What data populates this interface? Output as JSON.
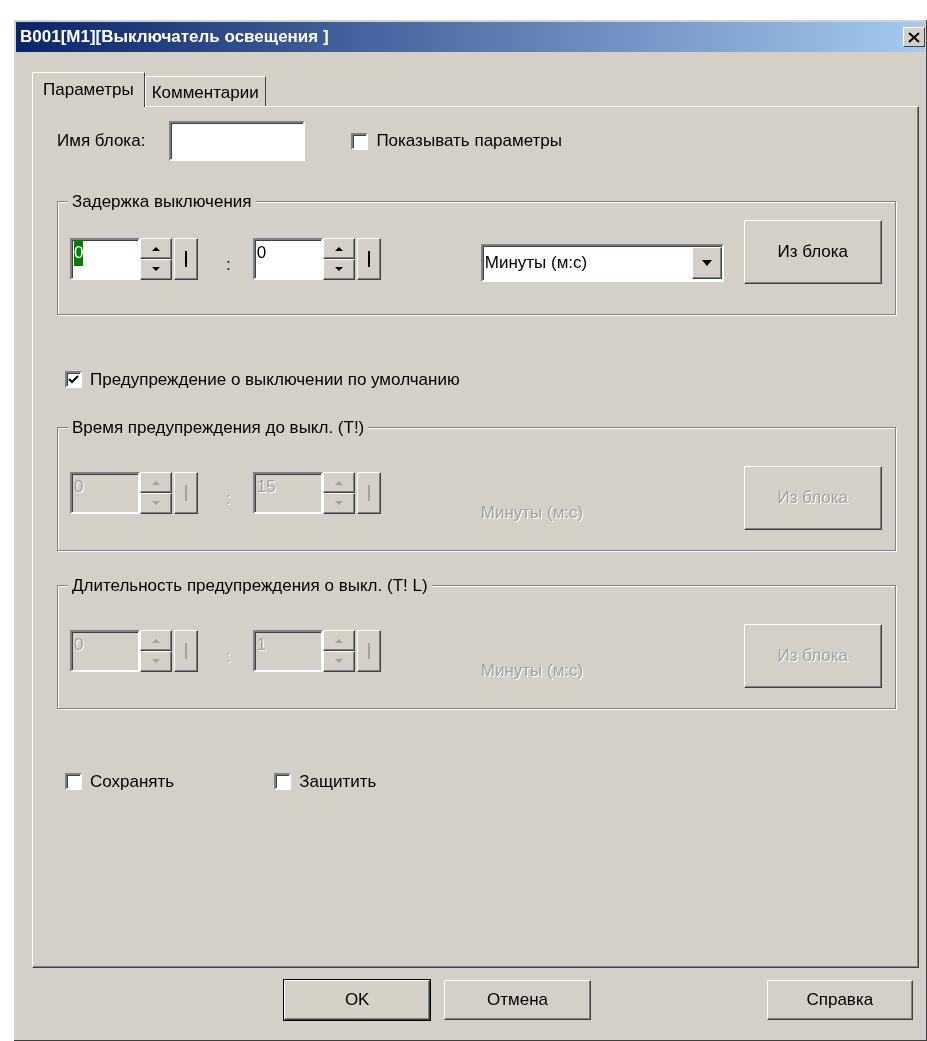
{
  "window": {
    "title": "B001[M1][Выключатель освещения ]"
  },
  "tabs": [
    {
      "label": "Параметры",
      "selected": true
    },
    {
      "label": "Комментарии",
      "selected": false
    }
  ],
  "block_name": {
    "label": "Имя блока:"
  },
  "show_params": {
    "label": "Показывать параметры",
    "checked": false
  },
  "groups": [
    {
      "title": "Задержка выключения",
      "disabled": false,
      "fields": [
        {
          "value": "0",
          "focused": true
        },
        {
          "value": "0",
          "focused": false
        }
      ],
      "separator": ":",
      "unit": {
        "kind": "select",
        "text": "Минуты (м:с)"
      },
      "button": "Из блока"
    },
    {
      "kind": "check",
      "label": "Предупреждение о выключении по умолчанию",
      "checked": true
    },
    {
      "title": "Время предупреждения до выкл. (T!)",
      "disabled": true,
      "fields": [
        {
          "value": "0",
          "focused": false
        },
        {
          "value": "15",
          "focused": false
        }
      ],
      "separator": ":",
      "unit": {
        "kind": "text",
        "text": "Минуты (м:с)"
      },
      "button": "Из блока"
    },
    {
      "title": "Длительность предупреждения о выкл. (T! L)",
      "disabled": true,
      "fields": [
        {
          "value": "0",
          "focused": false
        },
        {
          "value": "1",
          "focused": false
        }
      ],
      "separator": ":",
      "unit": {
        "kind": "text",
        "text": "Минуты (м:с)"
      },
      "button": "Из блока"
    }
  ],
  "options": [
    {
      "label": "Сохранять",
      "checked": false
    },
    {
      "label": "Защитить",
      "checked": false
    }
  ],
  "buttons": [
    {
      "label": "OK",
      "default": true
    },
    {
      "label": "Отмена",
      "default": false
    },
    {
      "label": "Справка",
      "default": false
    }
  ]
}
